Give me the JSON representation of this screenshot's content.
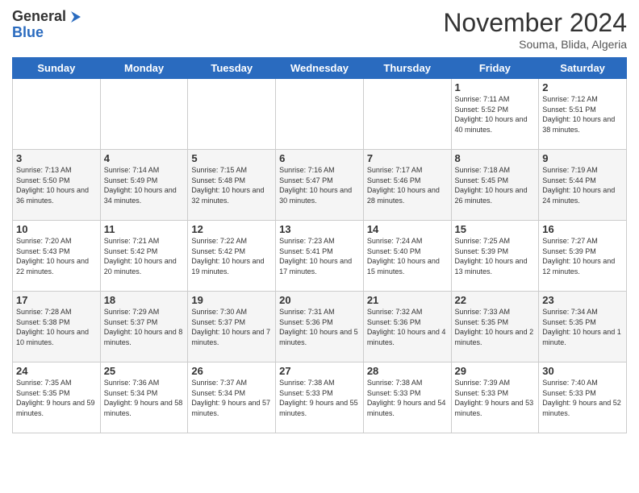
{
  "header": {
    "logo_line1": "General",
    "logo_line2": "Blue",
    "month_title": "November 2024",
    "location": "Souma, Blida, Algeria"
  },
  "weekdays": [
    "Sunday",
    "Monday",
    "Tuesday",
    "Wednesday",
    "Thursday",
    "Friday",
    "Saturday"
  ],
  "weeks": [
    [
      {
        "day": "",
        "info": ""
      },
      {
        "day": "",
        "info": ""
      },
      {
        "day": "",
        "info": ""
      },
      {
        "day": "",
        "info": ""
      },
      {
        "day": "",
        "info": ""
      },
      {
        "day": "1",
        "info": "Sunrise: 7:11 AM\nSunset: 5:52 PM\nDaylight: 10 hours and 40 minutes."
      },
      {
        "day": "2",
        "info": "Sunrise: 7:12 AM\nSunset: 5:51 PM\nDaylight: 10 hours and 38 minutes."
      }
    ],
    [
      {
        "day": "3",
        "info": "Sunrise: 7:13 AM\nSunset: 5:50 PM\nDaylight: 10 hours and 36 minutes."
      },
      {
        "day": "4",
        "info": "Sunrise: 7:14 AM\nSunset: 5:49 PM\nDaylight: 10 hours and 34 minutes."
      },
      {
        "day": "5",
        "info": "Sunrise: 7:15 AM\nSunset: 5:48 PM\nDaylight: 10 hours and 32 minutes."
      },
      {
        "day": "6",
        "info": "Sunrise: 7:16 AM\nSunset: 5:47 PM\nDaylight: 10 hours and 30 minutes."
      },
      {
        "day": "7",
        "info": "Sunrise: 7:17 AM\nSunset: 5:46 PM\nDaylight: 10 hours and 28 minutes."
      },
      {
        "day": "8",
        "info": "Sunrise: 7:18 AM\nSunset: 5:45 PM\nDaylight: 10 hours and 26 minutes."
      },
      {
        "day": "9",
        "info": "Sunrise: 7:19 AM\nSunset: 5:44 PM\nDaylight: 10 hours and 24 minutes."
      }
    ],
    [
      {
        "day": "10",
        "info": "Sunrise: 7:20 AM\nSunset: 5:43 PM\nDaylight: 10 hours and 22 minutes."
      },
      {
        "day": "11",
        "info": "Sunrise: 7:21 AM\nSunset: 5:42 PM\nDaylight: 10 hours and 20 minutes."
      },
      {
        "day": "12",
        "info": "Sunrise: 7:22 AM\nSunset: 5:42 PM\nDaylight: 10 hours and 19 minutes."
      },
      {
        "day": "13",
        "info": "Sunrise: 7:23 AM\nSunset: 5:41 PM\nDaylight: 10 hours and 17 minutes."
      },
      {
        "day": "14",
        "info": "Sunrise: 7:24 AM\nSunset: 5:40 PM\nDaylight: 10 hours and 15 minutes."
      },
      {
        "day": "15",
        "info": "Sunrise: 7:25 AM\nSunset: 5:39 PM\nDaylight: 10 hours and 13 minutes."
      },
      {
        "day": "16",
        "info": "Sunrise: 7:27 AM\nSunset: 5:39 PM\nDaylight: 10 hours and 12 minutes."
      }
    ],
    [
      {
        "day": "17",
        "info": "Sunrise: 7:28 AM\nSunset: 5:38 PM\nDaylight: 10 hours and 10 minutes."
      },
      {
        "day": "18",
        "info": "Sunrise: 7:29 AM\nSunset: 5:37 PM\nDaylight: 10 hours and 8 minutes."
      },
      {
        "day": "19",
        "info": "Sunrise: 7:30 AM\nSunset: 5:37 PM\nDaylight: 10 hours and 7 minutes."
      },
      {
        "day": "20",
        "info": "Sunrise: 7:31 AM\nSunset: 5:36 PM\nDaylight: 10 hours and 5 minutes."
      },
      {
        "day": "21",
        "info": "Sunrise: 7:32 AM\nSunset: 5:36 PM\nDaylight: 10 hours and 4 minutes."
      },
      {
        "day": "22",
        "info": "Sunrise: 7:33 AM\nSunset: 5:35 PM\nDaylight: 10 hours and 2 minutes."
      },
      {
        "day": "23",
        "info": "Sunrise: 7:34 AM\nSunset: 5:35 PM\nDaylight: 10 hours and 1 minute."
      }
    ],
    [
      {
        "day": "24",
        "info": "Sunrise: 7:35 AM\nSunset: 5:35 PM\nDaylight: 9 hours and 59 minutes."
      },
      {
        "day": "25",
        "info": "Sunrise: 7:36 AM\nSunset: 5:34 PM\nDaylight: 9 hours and 58 minutes."
      },
      {
        "day": "26",
        "info": "Sunrise: 7:37 AM\nSunset: 5:34 PM\nDaylight: 9 hours and 57 minutes."
      },
      {
        "day": "27",
        "info": "Sunrise: 7:38 AM\nSunset: 5:33 PM\nDaylight: 9 hours and 55 minutes."
      },
      {
        "day": "28",
        "info": "Sunrise: 7:38 AM\nSunset: 5:33 PM\nDaylight: 9 hours and 54 minutes."
      },
      {
        "day": "29",
        "info": "Sunrise: 7:39 AM\nSunset: 5:33 PM\nDaylight: 9 hours and 53 minutes."
      },
      {
        "day": "30",
        "info": "Sunrise: 7:40 AM\nSunset: 5:33 PM\nDaylight: 9 hours and 52 minutes."
      }
    ]
  ]
}
